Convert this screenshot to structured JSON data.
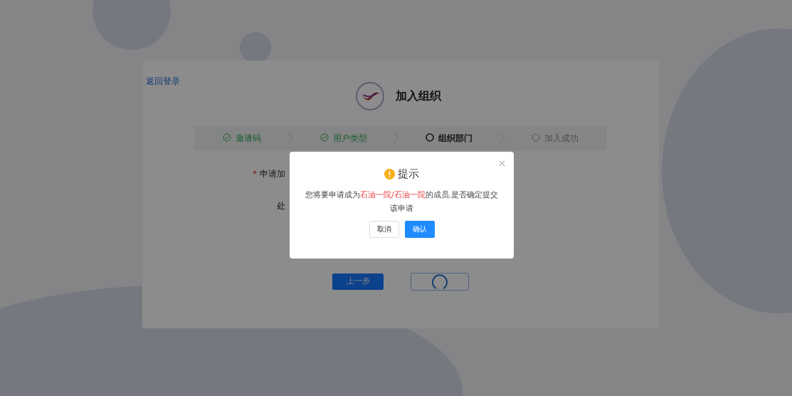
{
  "back_link": "返回登录",
  "title": "加入组织",
  "steps": [
    {
      "label": "邀请码",
      "completed": true,
      "selected": false
    },
    {
      "label": "用户类型",
      "completed": true,
      "selected": false
    },
    {
      "label": "组织部门",
      "completed": false,
      "selected": true
    },
    {
      "label": "加入成功",
      "completed": false,
      "selected": false
    }
  ],
  "form_fields": [
    {
      "required_mark": "*",
      "label": "申请加"
    },
    {
      "label": "处"
    }
  ],
  "footer_buttons": [
    {
      "kind": "primary",
      "label": "上一步"
    },
    {
      "kind": "loading"
    }
  ],
  "dialog": {
    "title": "提示",
    "message": [
      {
        "text": "您将要申请成为",
        "highlight": false
      },
      {
        "text": "石油一院/石油一院",
        "highlight": true
      },
      {
        "text": "的成员.是否确定提交该申请",
        "highlight": false
      }
    ],
    "buttons": [
      {
        "kind": "cancel",
        "label": "取消"
      },
      {
        "kind": "confirm",
        "label": "确认"
      }
    ]
  }
}
